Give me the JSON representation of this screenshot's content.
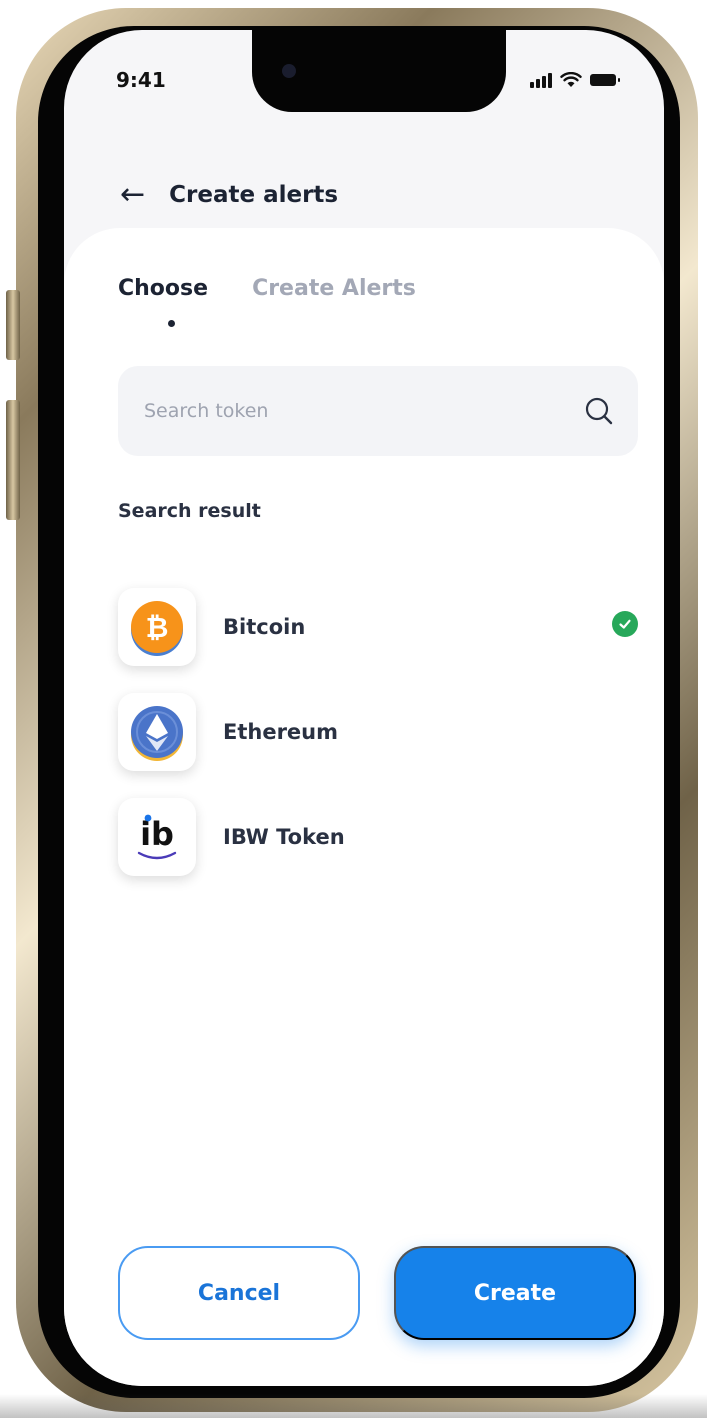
{
  "status_bar": {
    "time": "9:41"
  },
  "header": {
    "back_label": "←",
    "title": "Create alerts"
  },
  "tabs": [
    {
      "label": "Choose",
      "active": true
    },
    {
      "label": "Create Alerts",
      "active": false
    }
  ],
  "search": {
    "placeholder": "Search token",
    "value": ""
  },
  "results": {
    "title": "Search result",
    "items": [
      {
        "name": "Bitcoin",
        "icon": "bitcoin-icon",
        "selected": true,
        "icon_glyph": "₿"
      },
      {
        "name": "Ethereum",
        "icon": "ethereum-icon",
        "selected": false
      },
      {
        "name": "IBW Token",
        "icon": "ibw-token-icon",
        "selected": false,
        "icon_glyph": "ib"
      }
    ]
  },
  "actions": {
    "cancel_label": "Cancel",
    "create_label": "Create"
  },
  "colors": {
    "primary": "#1682ea",
    "text_dark": "#1c2333",
    "text_muted": "#a3a8b6",
    "selected_check": "#27a85a",
    "bitcoin_orange": "#f7931a",
    "ethereum_blue": "#4a74c9"
  }
}
